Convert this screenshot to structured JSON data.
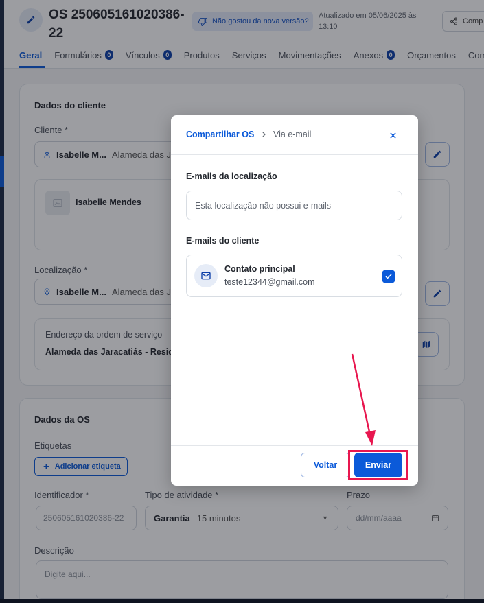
{
  "header": {
    "title": "OS 250605161020386-22",
    "feedback_label": "Não gostou da nova versão?",
    "updated_text": "Atualizado em 05/06/2025 às 13:10",
    "share_label": "Comp"
  },
  "tabs": [
    {
      "label": "Geral",
      "count": ""
    },
    {
      "label": "Formulários",
      "count": "0"
    },
    {
      "label": "Vínculos",
      "count": "0"
    },
    {
      "label": "Produtos",
      "count": ""
    },
    {
      "label": "Serviços",
      "count": ""
    },
    {
      "label": "Movimentações",
      "count": ""
    },
    {
      "label": "Anexos",
      "count": "0"
    },
    {
      "label": "Orçamentos",
      "count": ""
    },
    {
      "label": "Come",
      "count": ""
    }
  ],
  "client_card": {
    "title": "Dados do cliente",
    "client_label": "Cliente *",
    "client_name": "Isabelle M...",
    "client_address": "Alameda das Ja",
    "client_full_name": "Isabelle Mendes",
    "location_label": "Localização *",
    "location_name": "Isabelle M...",
    "location_address": "Alameda das Ja",
    "os_address_label": "Endereço da ordem de serviço",
    "os_address_value": "Alameda das Jaracatiás - Reside"
  },
  "os_card": {
    "title": "Dados da OS",
    "tags_label": "Etiquetas",
    "add_tag_label": "Adicionar etiqueta",
    "identifier_label": "Identificador *",
    "identifier_value": "250605161020386-22",
    "activity_label": "Tipo de atividade *",
    "activity_value": "Garantia",
    "activity_duration": "15 minutos",
    "deadline_label": "Prazo",
    "deadline_placeholder": "dd/mm/aaaa",
    "description_label": "Descrição",
    "description_placeholder": "Digite aqui..."
  },
  "modal": {
    "breadcrumb_main": "Compartilhar OS",
    "breadcrumb_sub": "Via e-mail",
    "location_emails_title": "E-mails da localização",
    "location_emails_empty": "Esta localização não possui e-mails",
    "client_emails_title": "E-mails do cliente",
    "contact_name": "Contato principal",
    "contact_email": "teste12344@gmail.com",
    "contact_checked": true,
    "back_label": "Voltar",
    "send_label": "Enviar"
  },
  "annotation": {
    "color": "#e8174f",
    "target": "Enviar"
  },
  "colors": {
    "primary": "#0b5ad9",
    "overlay": "rgba(18,22,30,0.42)"
  }
}
